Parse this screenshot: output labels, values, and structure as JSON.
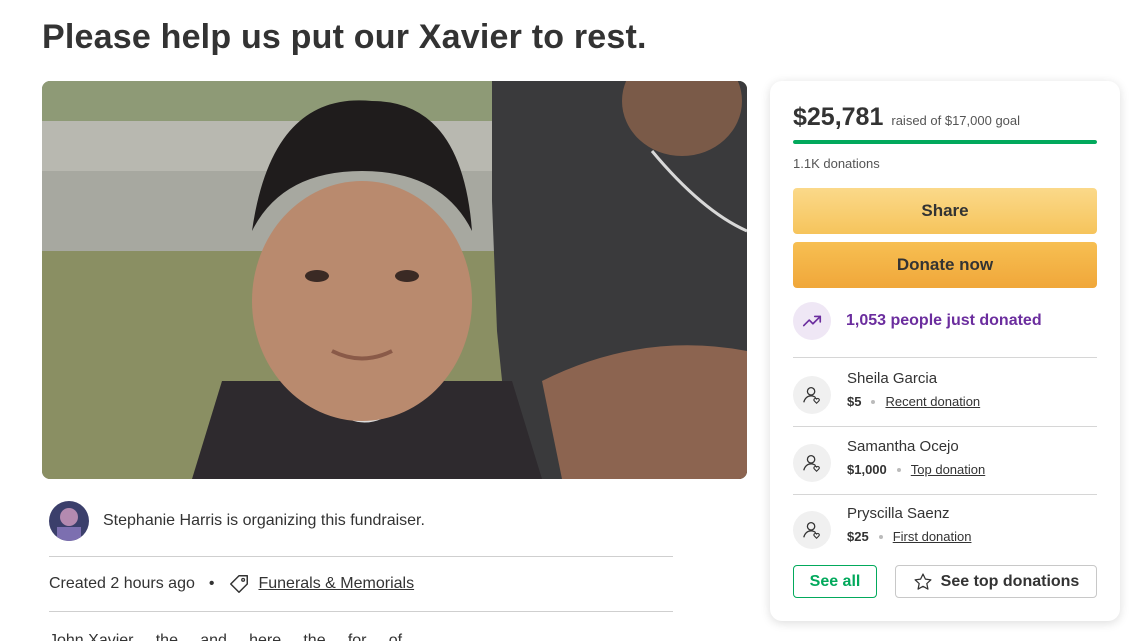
{
  "page": {
    "title": "Please help us put our Xavier to rest."
  },
  "organizer": {
    "text": "Stephanie Harris is organizing this fundraiser."
  },
  "meta": {
    "created": "Created 2 hours ago",
    "separator": "•",
    "category": "Funerals & Memorials",
    "category_icon": "tag-icon"
  },
  "story": {
    "teaser": "John Xavier ... the ... and ... here ... the ... for ... of ..."
  },
  "donation_card": {
    "amount": "$25,781",
    "goal_text": "raised of $17,000 goal",
    "progress_fraction": 1.0,
    "donations_count": "1.1K donations",
    "share_label": "Share",
    "donate_label": "Donate now",
    "trend_icon": "trending-up-icon",
    "trend_text": "1,053 people just donated",
    "donors": [
      {
        "name": "Sheila Garcia",
        "amount": "$5",
        "type": "Recent donation"
      },
      {
        "name": "Samantha Ocejo",
        "amount": "$1,000",
        "type": "Top donation"
      },
      {
        "name": "Pryscilla Saenz",
        "amount": "$25",
        "type": "First donation"
      }
    ],
    "see_all_label": "See all",
    "see_top_label": "See top donations"
  },
  "colors": {
    "progress_green": "#02a95c",
    "share_button": "#f6c45c",
    "donate_button": "#f0a73a",
    "trend_purple": "#6b2d9e"
  }
}
